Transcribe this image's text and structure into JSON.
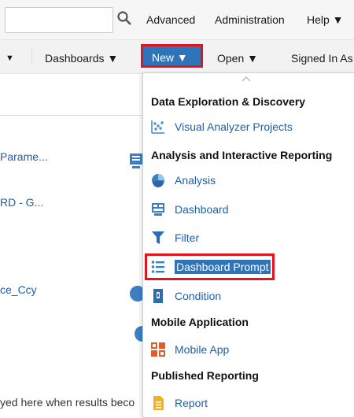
{
  "topbar": {
    "advanced": "Advanced",
    "administration": "Administration",
    "help": "Help ▼"
  },
  "nav": {
    "first_arrow": "▼",
    "dashboards": "Dashboards ▼",
    "new": "New ▼",
    "open": "Open ▼",
    "signed_in": "Signed In As"
  },
  "background": {
    "item1": "Parame...",
    "item2": "RD - G...",
    "item3": "ce_Ccy",
    "footer": "yed here when results beco"
  },
  "menu": {
    "sections": [
      {
        "header": "Data Exploration & Discovery",
        "items": [
          {
            "label": "Visual Analyzer Projects",
            "icon": "visual-analyzer-icon"
          }
        ]
      },
      {
        "header": "Analysis and Interactive Reporting",
        "items": [
          {
            "label": "Analysis",
            "icon": "analysis-icon"
          },
          {
            "label": "Dashboard",
            "icon": "dashboard-icon"
          },
          {
            "label": "Filter",
            "icon": "filter-icon"
          },
          {
            "label": "Dashboard Prompt",
            "icon": "dashboard-prompt-icon",
            "selected": true
          },
          {
            "label": "Condition",
            "icon": "condition-icon"
          }
        ]
      },
      {
        "header": "Mobile Application",
        "items": [
          {
            "label": "Mobile App",
            "icon": "mobile-app-icon"
          }
        ]
      },
      {
        "header": "Published Reporting",
        "items": [
          {
            "label": "Report",
            "icon": "report-icon"
          }
        ]
      }
    ]
  },
  "colors": {
    "accent": "#2f74b8",
    "highlight_border": "#e2151e",
    "link": "#1f5fa6"
  }
}
